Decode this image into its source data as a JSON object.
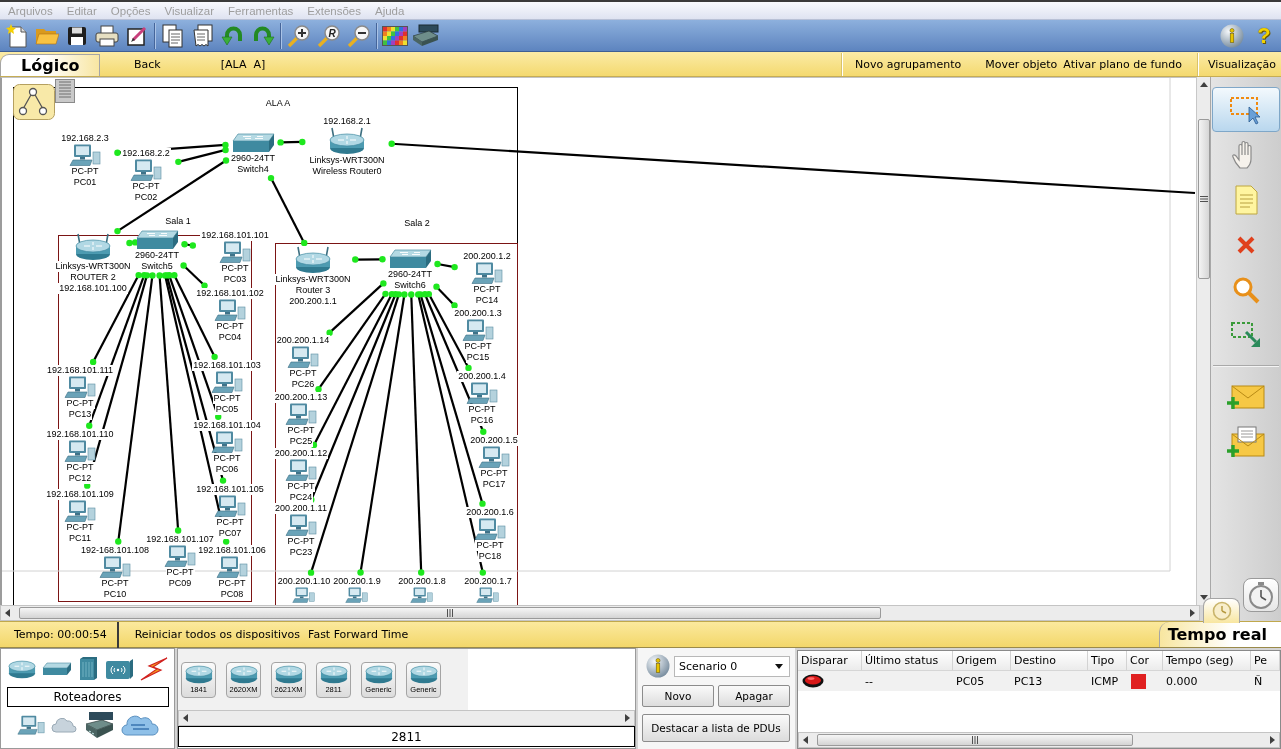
{
  "menu_bar": {
    "items": [
      "Arquivos",
      "Editar",
      "Opções",
      "Visualizar",
      "Ferramentas",
      "Extensões",
      "Ajuda"
    ]
  },
  "toolbar": {
    "zoom_reset_mark": "R",
    "help": "?"
  },
  "workspace_bar": {
    "tab": "Lógico",
    "back": "Back",
    "path": "[ALA  A]",
    "actions": [
      "Novo agrupamento",
      "Mover objeto",
      "Ativar plano de fundo"
    ],
    "view": "Visualização"
  },
  "topology": {
    "areas": [
      {
        "kind": "cluster",
        "label": "ALA A"
      },
      {
        "kind": "room",
        "label": "Sala 1"
      },
      {
        "kind": "room",
        "label": "Sala 2"
      }
    ],
    "devices": [
      {
        "kind": "pc",
        "ip": "192.168.2.3",
        "model": "PC-PT",
        "name": "PC01"
      },
      {
        "kind": "pc",
        "ip": "192.168.2.2",
        "model": "PC-PT",
        "name": "PC02"
      },
      {
        "kind": "switch",
        "model": "2960-24TT",
        "name": "Switch4"
      },
      {
        "kind": "wireless_router",
        "ip": "192.168.2.1",
        "model": "Linksys-WRT300N",
        "name": "Wireless Router0"
      },
      {
        "kind": "wireless_router",
        "model": "Linksys-WRT300N",
        "name": "ROUTER 2",
        "ip": "192.168.101.100"
      },
      {
        "kind": "switch",
        "model": "2960-24TT",
        "name": "Switch5"
      },
      {
        "kind": "pc",
        "ip": "192.168.101.111",
        "model": "PC-PT",
        "name": "PC13"
      },
      {
        "kind": "pc",
        "ip": "192.168.101.110",
        "model": "PC-PT",
        "name": "PC12"
      },
      {
        "kind": "pc",
        "ip": "192.168.101.109",
        "model": "PC-PT",
        "name": "PC11"
      },
      {
        "kind": "pc",
        "ip": "192.168.101.101",
        "model": "PC-PT",
        "name": "PC03"
      },
      {
        "kind": "pc",
        "ip": "192.168.101.102",
        "model": "PC-PT",
        "name": "PC04"
      },
      {
        "kind": "pc",
        "ip": "192.168.101.103",
        "model": "PC-PT",
        "name": "PC05"
      },
      {
        "kind": "pc",
        "ip": "192.168.101.104",
        "model": "PC-PT",
        "name": "PC06"
      },
      {
        "kind": "pc",
        "ip": "192.168.101.105",
        "model": "PC-PT",
        "name": "PC07"
      },
      {
        "kind": "pc",
        "ip": "192-168.101.108",
        "model": "PC-PT",
        "name": "PC10"
      },
      {
        "kind": "pc",
        "ip": "192.168.101.107",
        "model": "PC-PT",
        "name": "PC09"
      },
      {
        "kind": "pc",
        "ip": "192.168.101.106",
        "model": "PC-PT",
        "name": "PC08"
      },
      {
        "kind": "wireless_router",
        "model": "Linksys-WRT300N",
        "name": "Router 3",
        "ip": "200.200.1.1"
      },
      {
        "kind": "switch",
        "model": "2960-24TT",
        "name": "Switch6"
      },
      {
        "kind": "pc",
        "ip": "200.200.1.14",
        "model": "PC-PT",
        "name": "PC26"
      },
      {
        "kind": "pc",
        "ip": "200.200.1.13",
        "model": "PC-PT",
        "name": "PC25"
      },
      {
        "kind": "pc",
        "ip": "200.200.1.12",
        "model": "PC-PT",
        "name": "PC24"
      },
      {
        "kind": "pc",
        "ip": "200.200.1.11",
        "model": "PC-PT",
        "name": "PC23"
      },
      {
        "kind": "pc",
        "ip": "200.200.1.2",
        "model": "PC-PT",
        "name": "PC14"
      },
      {
        "kind": "pc",
        "ip": "200.200.1.3",
        "model": "PC-PT",
        "name": "PC15"
      },
      {
        "kind": "pc",
        "ip": "200.200.1.4",
        "model": "PC-PT",
        "name": "PC16"
      },
      {
        "kind": "pc",
        "ip": "200.200.1.5",
        "model": "PC-PT",
        "name": "PC17"
      },
      {
        "kind": "pc",
        "ip": "200.200.1.6",
        "model": "PC-PT",
        "name": "PC18"
      },
      {
        "kind": "pc",
        "ip": "200.200.1.10"
      },
      {
        "kind": "pc",
        "ip": "200.200.1.9"
      },
      {
        "kind": "pc",
        "ip": "200.200.1.8"
      },
      {
        "kind": "pc",
        "ip": "200.200.1.7"
      }
    ]
  },
  "time_bar": {
    "time": "Tempo: 00:00:54",
    "actions": [
      "Reiniciar todos os dispositivos",
      "Fast Forward Time"
    ],
    "mode": "Tempo real"
  },
  "device_panel": {
    "category": "Roteadores",
    "models": [
      "1841",
      "2620XM",
      "2621XM",
      "2811",
      "Generic",
      "Generic"
    ],
    "model_name": "2811"
  },
  "scenario_panel": {
    "scenario": "Scenario 0",
    "buttons": [
      "Novo",
      "Apagar"
    ],
    "list_button": "Destacar a lista de PDUs"
  },
  "pdu_table": {
    "columns": [
      "Disparar",
      "Último status",
      "Origem",
      "Destino",
      "Tipo",
      "Cor",
      "Tempo (seg)",
      "Pe"
    ],
    "rows": [
      {
        "last_status": "--",
        "source": "PC05",
        "destination": "PC13",
        "type": "ICMP",
        "color": "#e02020",
        "time": "0.000",
        "column_8": "Ñ"
      }
    ]
  }
}
